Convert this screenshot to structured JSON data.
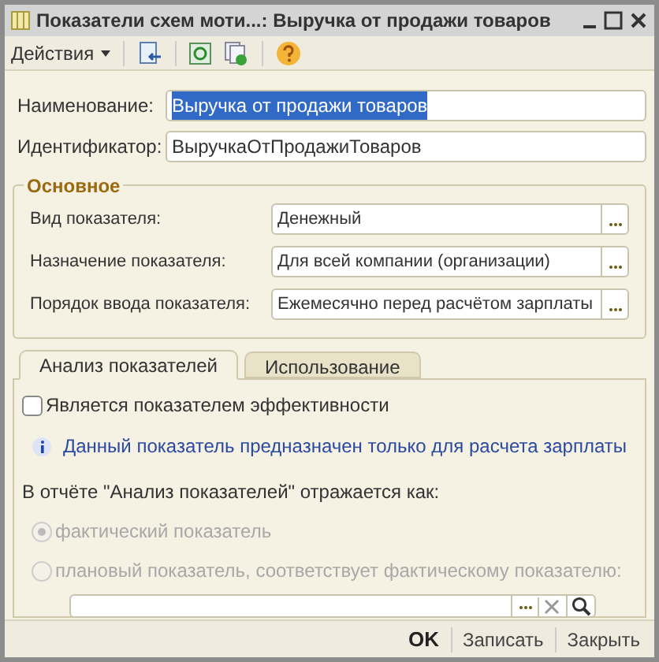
{
  "window": {
    "title": "Показатели схем моти...: Выручка от продажи товаров"
  },
  "toolbar": {
    "actions_menu": "Действия"
  },
  "fields": [
    {
      "label": "Наименование:",
      "value": "Выручка от продажи товаров",
      "selected": true
    },
    {
      "label": "Идентификатор:",
      "value": "ВыручкаОтПродажиТоваров",
      "selected": false
    }
  ],
  "group": {
    "title": "Основное",
    "fields": [
      {
        "label": "Вид показателя:",
        "value": "Денежный"
      },
      {
        "label": "Назначение показателя:",
        "value": "Для всей компании (организации)"
      },
      {
        "label": "Порядок ввода показателя:",
        "value": "Ежемесячно перед расчётом зарплаты"
      }
    ]
  },
  "tabs": [
    {
      "label": "Анализ показателей",
      "selected": true
    },
    {
      "label": "Использование",
      "selected": false
    }
  ],
  "panel": {
    "checkbox": {
      "label": "Является показателем эффективности",
      "checked": false
    },
    "info": "Данный показатель предназначен только для расчета зарплаты",
    "report_label": "В отчёте \"Анализ показателей\" отражается как:",
    "radios": [
      {
        "label": "фактический показатель",
        "selected": true,
        "disabled": true
      },
      {
        "label": "плановый показатель, соответствует фактическому показателю:",
        "selected": false,
        "disabled": true
      }
    ]
  },
  "buttons": [
    {
      "label": "OK",
      "kind": "default"
    },
    {
      "label": "Записать",
      "kind": "plain"
    },
    {
      "label": "Закрыть",
      "kind": "plain"
    }
  ]
}
